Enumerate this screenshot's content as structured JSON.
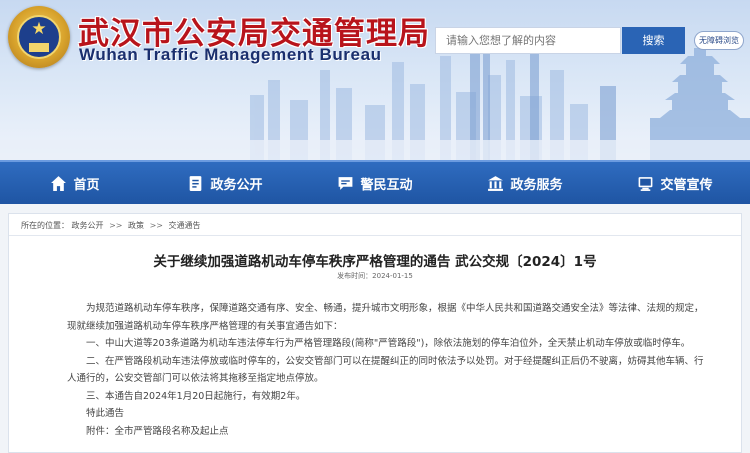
{
  "header": {
    "title": "武汉市公安局交通管理局",
    "subtitle": "Wuhan Traffic Management Bureau",
    "search_placeholder": "请输入您想了解的内容",
    "search_button": "搜索",
    "accessibility_button": "无障碍浏览"
  },
  "nav": {
    "items": [
      {
        "label": "首页",
        "icon": "home-icon"
      },
      {
        "label": "政务公开",
        "icon": "document-icon"
      },
      {
        "label": "警民互动",
        "icon": "chat-icon"
      },
      {
        "label": "政务服务",
        "icon": "building-icon"
      },
      {
        "label": "交管宣传",
        "icon": "megaphone-icon"
      }
    ]
  },
  "breadcrumb": {
    "prefix": "所在的位置：",
    "items": [
      "政务公开",
      "政策",
      "交通通告"
    ],
    "separator": ">>"
  },
  "article": {
    "title": "关于继续加强道路机动车停车秩序严格管理的通告 武公交规〔2024〕1号",
    "date": "发布时间：2024-01-15",
    "paragraphs": [
      "为规范道路机动车停车秩序，保障道路交通有序、安全、畅通，提升城市文明形象，根据《中华人民共和国道路交通安全法》等法律、法规的规定，现就继续加强道路机动车停车秩序严格管理的有关事宜通告如下：",
      "一、中山大道等203条道路为机动车违法停车行为严格管理路段(简称\"严管路段\")，除依法施划的停车泊位外，全天禁止机动车停放或临时停车。",
      "二、在严管路段机动车违法停放或临时停车的，公安交管部门可以在提醒纠正的同时依法予以处罚。对于经提醒纠正后仍不驶离，妨碍其他车辆、行人通行的，公安交管部门可以依法将其拖移至指定地点停放。",
      "三、本通告自2024年1月20日起施行，有效期2年。",
      "特此通告",
      "附件：全市严管路段名称及起止点"
    ]
  }
}
